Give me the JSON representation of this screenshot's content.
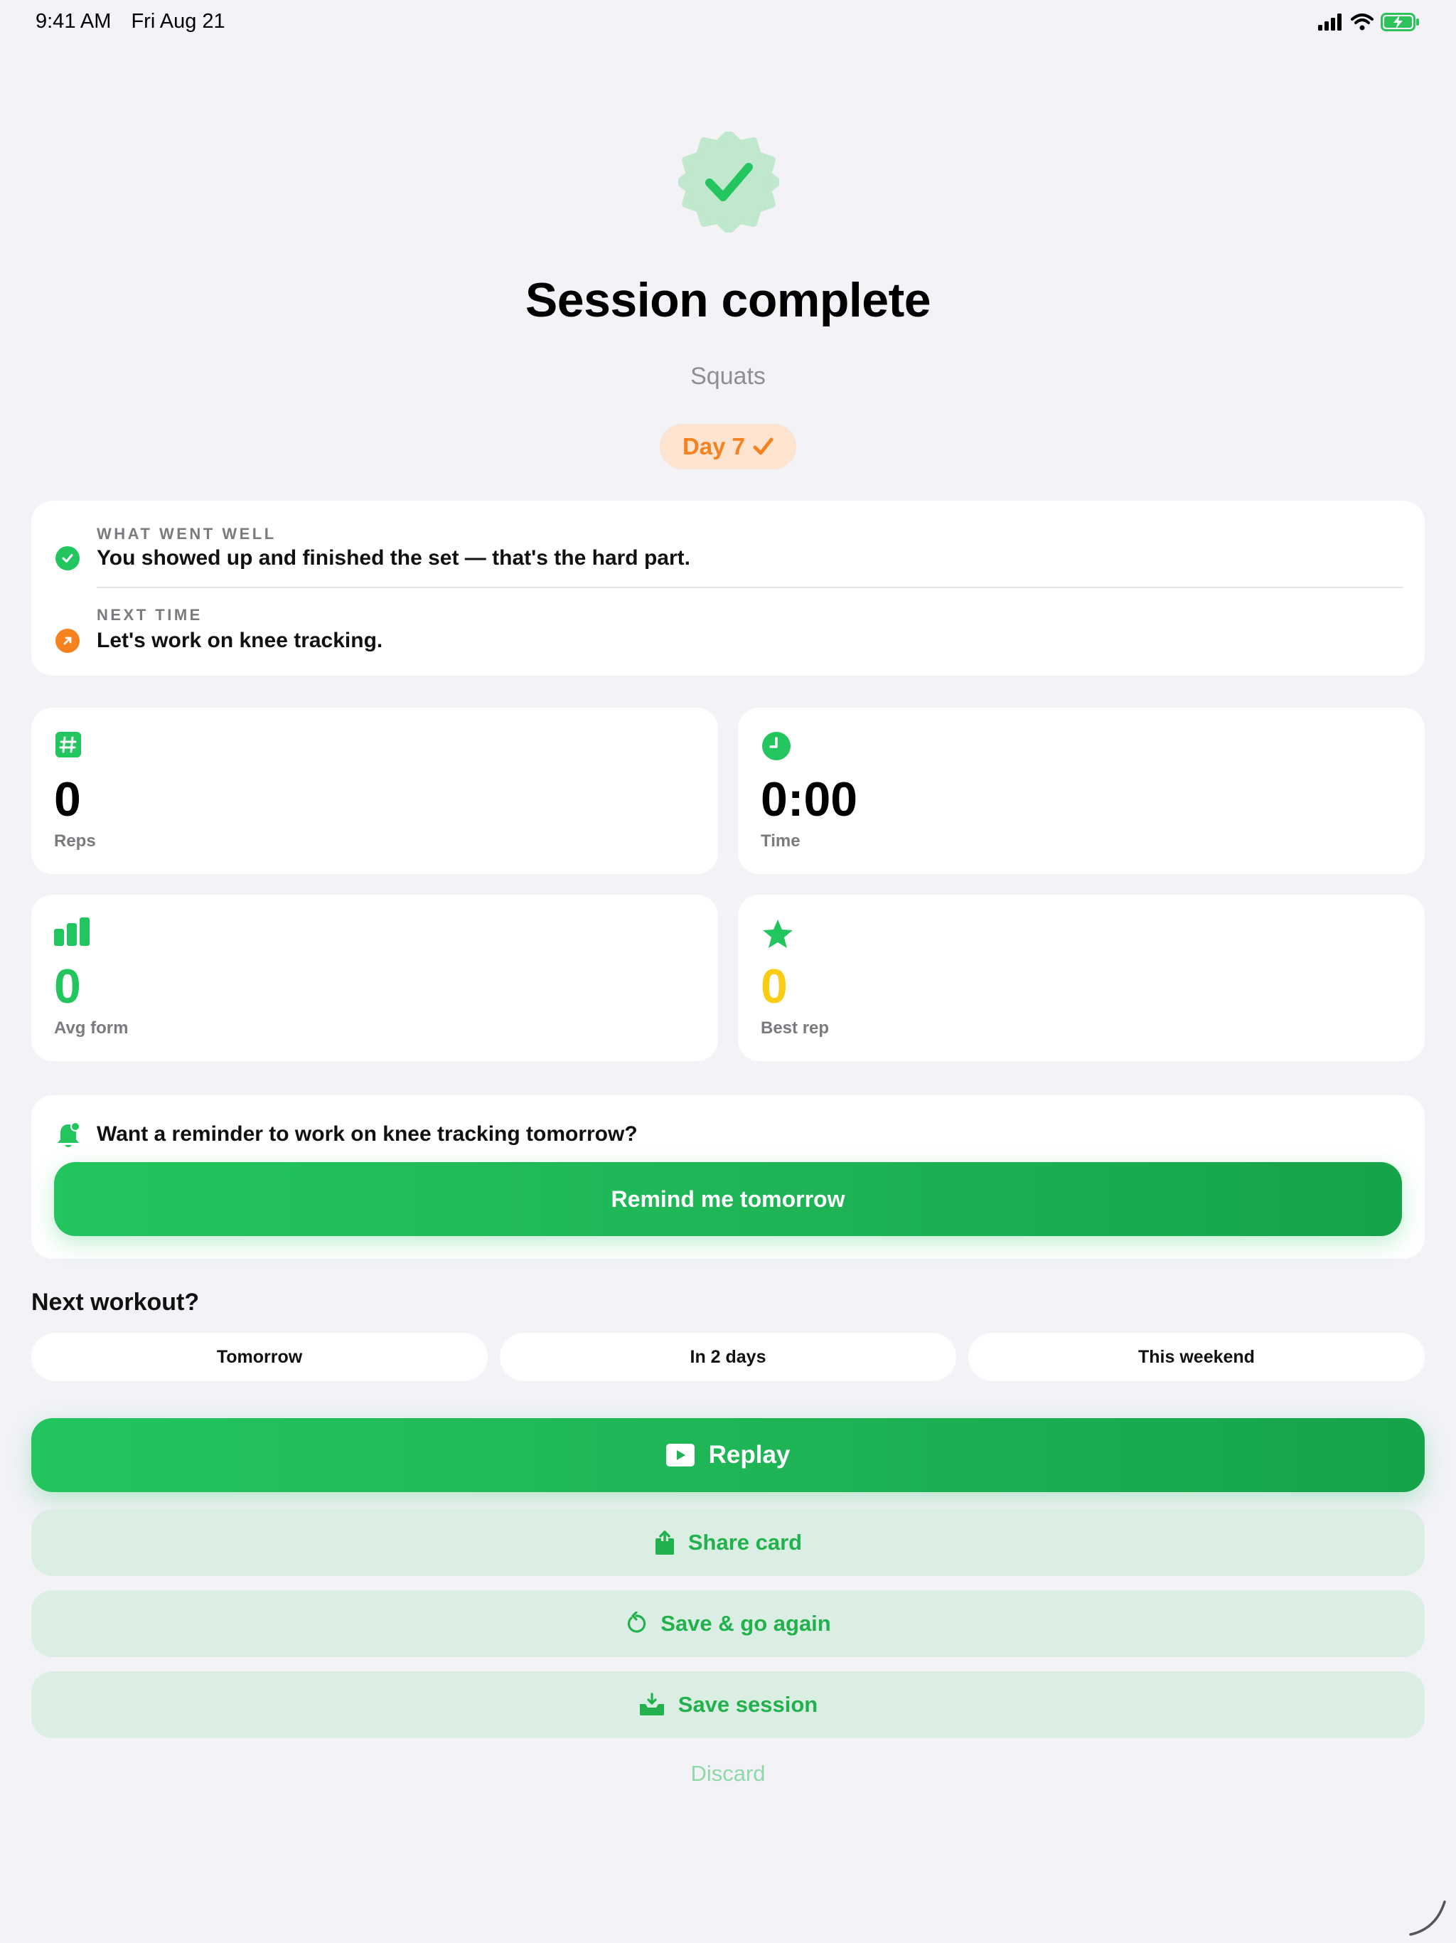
{
  "status_bar": {
    "time": "9:41 AM",
    "date": "Fri Aug 21",
    "icons": [
      "cellular-signal-icon",
      "wifi-icon",
      "battery-charging-icon"
    ]
  },
  "header": {
    "badge_icon": "checkmark-seal-icon",
    "title": "Session complete",
    "exercise": "Squats",
    "streak_label": "Day 7",
    "streak_icon": "checkmark-icon"
  },
  "feedback": {
    "went_well_label": "WHAT WENT WELL",
    "went_well_text": "You showed up and finished the set — that's the hard part.",
    "next_time_label": "NEXT TIME",
    "next_time_text": "Let's work on knee tracking."
  },
  "stats": [
    {
      "icon": "number-sign-icon",
      "value": "0",
      "label": "Reps",
      "color": "#000000"
    },
    {
      "icon": "clock-icon",
      "value": "0:00",
      "label": "Time",
      "color": "#000000"
    },
    {
      "icon": "bar-chart-icon",
      "value": "0",
      "label": "Avg form",
      "color": "#22c55e"
    },
    {
      "icon": "star-icon",
      "value": "0",
      "label": "Best rep",
      "color": "#facc15"
    }
  ],
  "reminder": {
    "icon": "bell-badge-icon",
    "prompt": "Want a reminder to work on knee tracking tomorrow?",
    "button_label": "Remind me tomorrow"
  },
  "next_workout": {
    "heading": "Next workout?",
    "options": [
      "Tomorrow",
      "In 2 days",
      "This weekend"
    ]
  },
  "actions": {
    "replay": "Replay",
    "share": "Share card",
    "save_again": "Save & go again",
    "save": "Save session",
    "discard": "Discard"
  },
  "colors": {
    "accent": "#22c55e",
    "streak": "#f5821f",
    "background": "#f2f2f7"
  }
}
